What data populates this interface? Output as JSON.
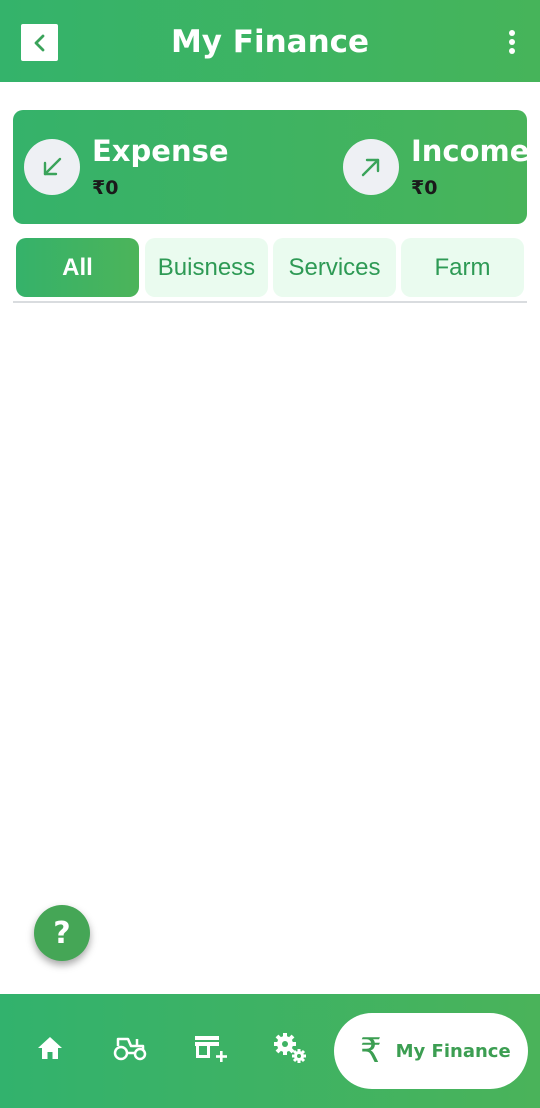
{
  "appbar": {
    "title": "My Finance"
  },
  "summary": {
    "expense": {
      "label": "Expense",
      "value": "₹0"
    },
    "income": {
      "label": "Income",
      "value": "₹0"
    }
  },
  "tabs": [
    {
      "label": "All",
      "active": true
    },
    {
      "label": "Buisness",
      "active": false
    },
    {
      "label": "Services",
      "active": false
    },
    {
      "label": "Farm",
      "active": false
    }
  ],
  "help": {
    "label": "?"
  },
  "bottom_nav": {
    "items": [
      {
        "icon": "home-icon"
      },
      {
        "icon": "tractor-icon"
      },
      {
        "icon": "add-store-icon"
      },
      {
        "icon": "gears-icon"
      }
    ],
    "active": {
      "icon": "rupee-icon",
      "glyph": "₹",
      "label": "My Finance"
    }
  },
  "colors": {
    "primary_green": "#35b26a",
    "accent_green": "#48b45a",
    "tab_inactive_bg": "#eafbef",
    "tab_inactive_text": "#2e9a55"
  }
}
